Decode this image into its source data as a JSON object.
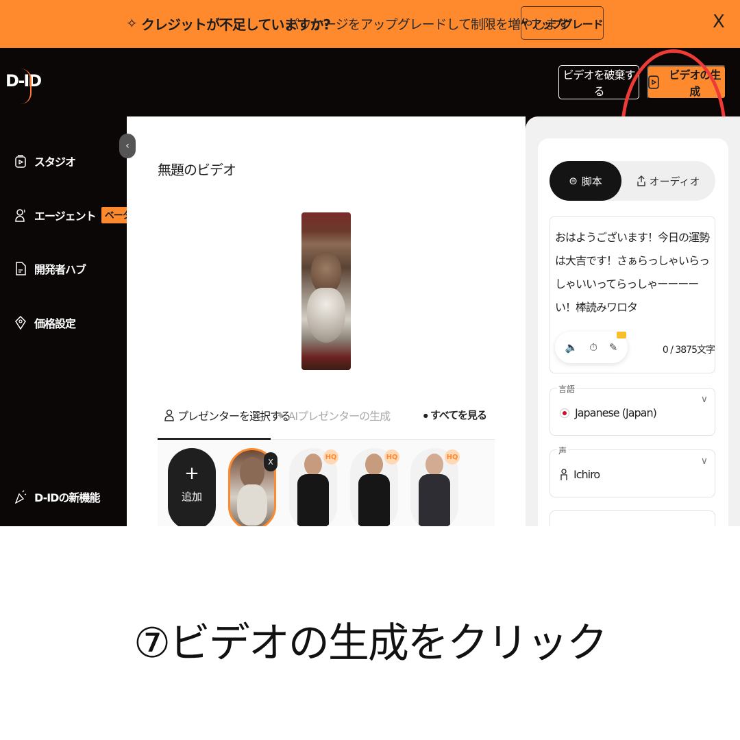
{
  "banner": {
    "sparkle_icon": "sparkle-icon",
    "bold_text": "クレジットが不足していますか?",
    "text": "パッケージをアップグレードして制限を増やします",
    "upgrade_label": "アップグレード",
    "close_label": "X",
    "color": "#ff8a2e"
  },
  "header": {
    "logo": "D-ID",
    "discard_label": "ビデオを破棄する",
    "generate_label": "ビデオの生成",
    "accent": "#ff8a2e"
  },
  "sidebar": {
    "items": [
      {
        "label": "スタジオ",
        "icon": "studio-icon"
      },
      {
        "label": "エージェント",
        "icon": "agent-icon",
        "badge": "ベータ"
      },
      {
        "label": "開発者ハブ",
        "icon": "document-icon"
      },
      {
        "label": "価格設定",
        "icon": "price-tag-icon"
      }
    ],
    "footer_label": "D-IDの新機能",
    "collapse_glyph": "‹"
  },
  "main": {
    "title": "無題のビデオ",
    "tabs": [
      {
        "label": "プレゼンターを選択する",
        "active": true
      },
      {
        "label": "AIプレゼンターの生成",
        "active": false
      }
    ],
    "see_all": "すべてを見る",
    "add_label": "追加",
    "add_glyph": "+",
    "remove_glyph": "X",
    "hq_badge": "HQ"
  },
  "panel": {
    "tabs": [
      {
        "label": "脚本",
        "active": true
      },
      {
        "label": "オーディオ",
        "active": false
      }
    ],
    "script_text": "おはようございます！今日の運勢は大吉です！さぁらっしゃいらっしゃいいってらっしゃーーーーい！棒読みワロタ",
    "char_count": "0 / 3875文字",
    "language": {
      "label": "言語",
      "value": "Japanese (Japan)"
    },
    "voice": {
      "label": "声",
      "value": "Ichiro"
    }
  },
  "caption": "⑦ビデオの生成をクリック",
  "colors": {
    "highlight_circle": "#ee3b36"
  }
}
